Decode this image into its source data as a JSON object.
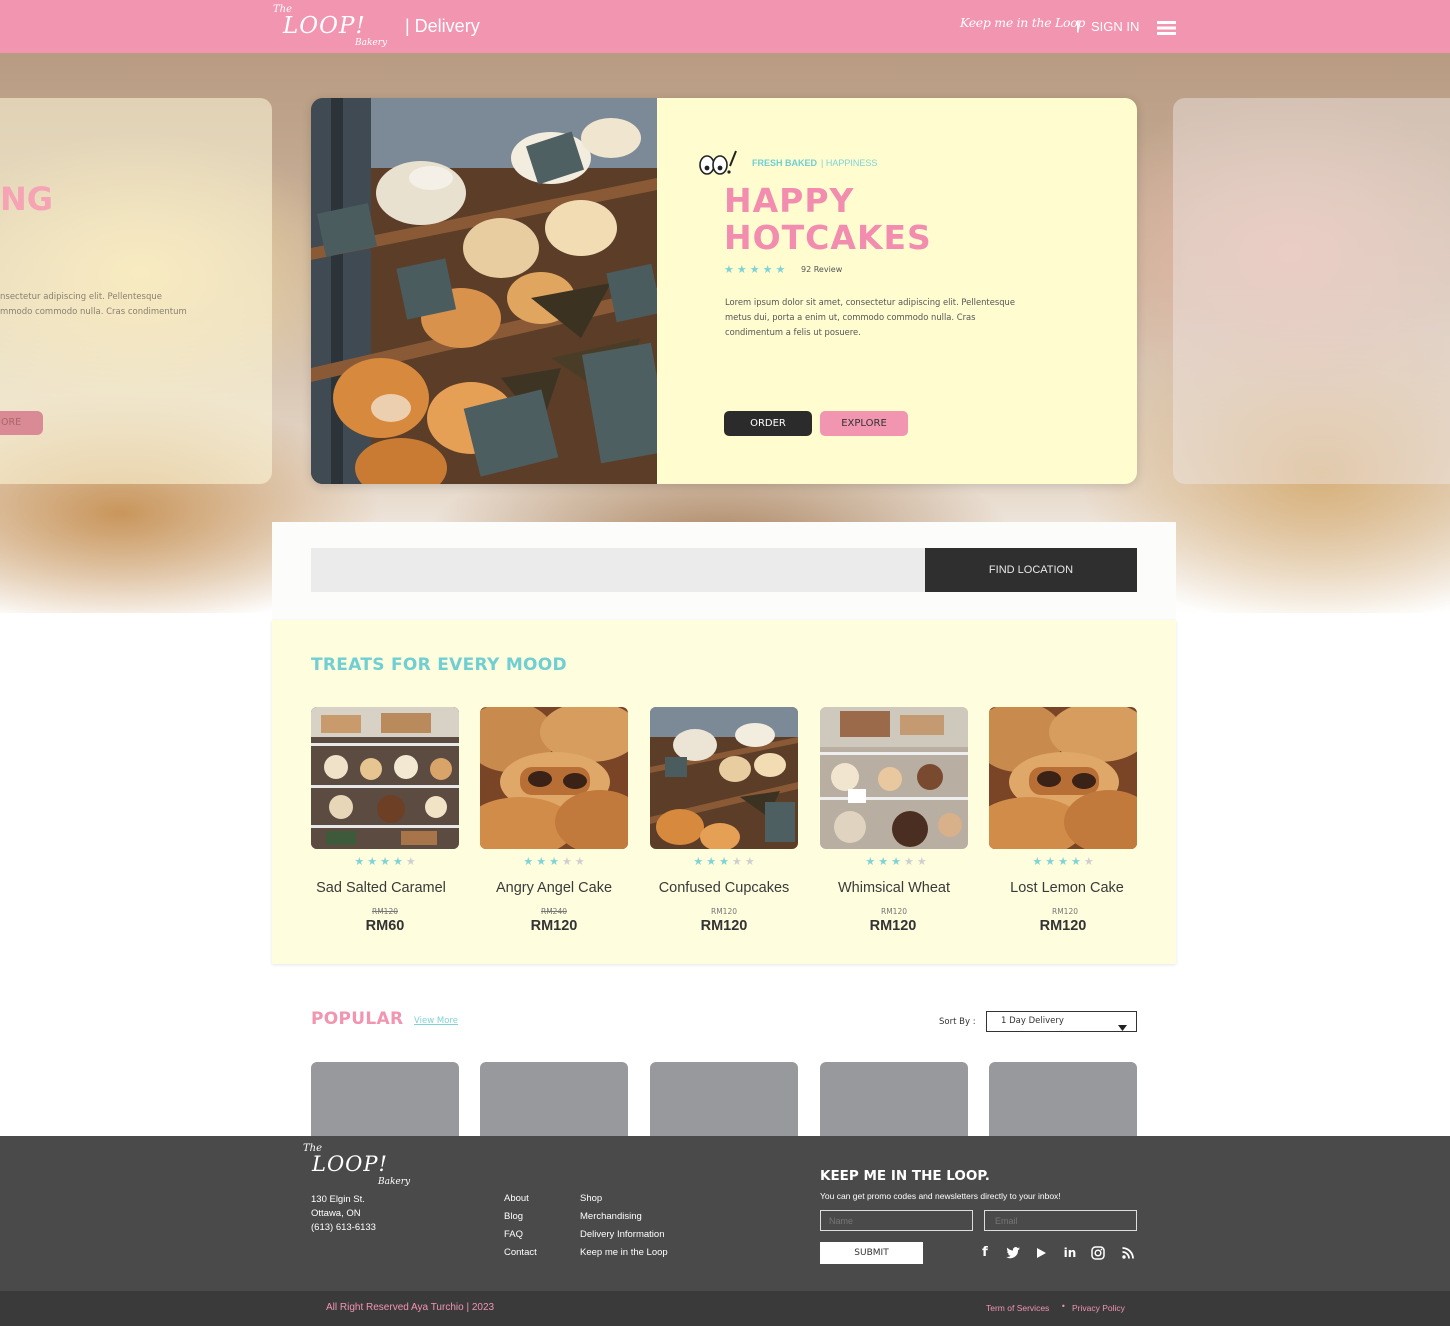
{
  "header": {
    "logo": {
      "the": "The",
      "loop": "LOOP!",
      "bakery": "Bakery"
    },
    "section": "| Delivery",
    "tagline": "Keep me in the Loop",
    "divider": "|",
    "signin": "SIGN IN",
    "menu_icon": "hamburger-icon"
  },
  "hero": {
    "left_card": {
      "title_fragment": "NG",
      "text_line1": "nsectetur adipiscing elit. Pellentesque",
      "text_line2": "mmodo commodo nulla. Cras condimentum",
      "button": "ORE"
    },
    "eyes_mark": "OO!",
    "kicker_strong": "FRESH BAKED",
    "kicker_rest": "| HAPPINESS",
    "title_line1": "HAPPY",
    "title_line2": "HOTCAKES",
    "rating": 5,
    "reviews": "92 Review",
    "description": "Lorem ipsum dolor sit amet, consectetur adipiscing elit. Pellentesque metus dui, porta a enim ut, commodo commodo nulla. Cras condimentum a felis ut posuere.",
    "order_label": "ORDER",
    "explore_label": "EXPLORE"
  },
  "search": {
    "placeholder": "",
    "button": "FIND LOCATION"
  },
  "treats": {
    "heading": "TREATS FOR EVERY MOOD",
    "items": [
      {
        "name": "Sad Salted Caramel",
        "old_price": "RM120",
        "price": "RM60",
        "stars": 4
      },
      {
        "name": "Angry Angel Cake",
        "old_price": "RM240",
        "price": "RM120",
        "stars": 3
      },
      {
        "name": "Confused Cupcakes",
        "old_price": "RM120",
        "price": "RM120",
        "stars": 3
      },
      {
        "name": "Whimsical Wheat",
        "old_price": "RM120",
        "price": "RM120",
        "stars": 3
      },
      {
        "name": "Lost Lemon Cake",
        "old_price": "RM120",
        "price": "RM120",
        "stars": 4
      }
    ]
  },
  "popular": {
    "heading": "POPULAR",
    "view_more": "View More",
    "sort_label": "Sort By :",
    "sort_value": "1 Day Delivery"
  },
  "footer": {
    "address": [
      "130 Elgin St.",
      "Ottawa, ON",
      "(613) 613-6133"
    ],
    "links_col1": [
      "About",
      "Blog",
      "FAQ",
      "Contact"
    ],
    "links_col2": [
      "Shop",
      "Merchandising",
      "Delivery Information",
      "Keep me in the Loop"
    ],
    "newsletter": {
      "title": "KEEP ME IN THE LOOP.",
      "subtitle": "You can get promo codes and newsletters directly to your inbox!",
      "name_placeholder": "Name",
      "email_placeholder": "Email",
      "submit": "SUBMIT"
    },
    "social_icons": [
      "facebook-icon",
      "twitter-icon",
      "youtube-icon",
      "linkedin-icon",
      "instagram-icon",
      "rss-icon"
    ],
    "copyright": "All Right Reserved Aya Turchio | 2023",
    "terms": "Term of Services",
    "sep": "•",
    "privacy": "Privacy Policy"
  },
  "colors": {
    "brand_pink": "#f195b1",
    "accent_teal": "#7fd3d5",
    "cream": "#fffdd0",
    "dark": "#2f2f2f"
  }
}
